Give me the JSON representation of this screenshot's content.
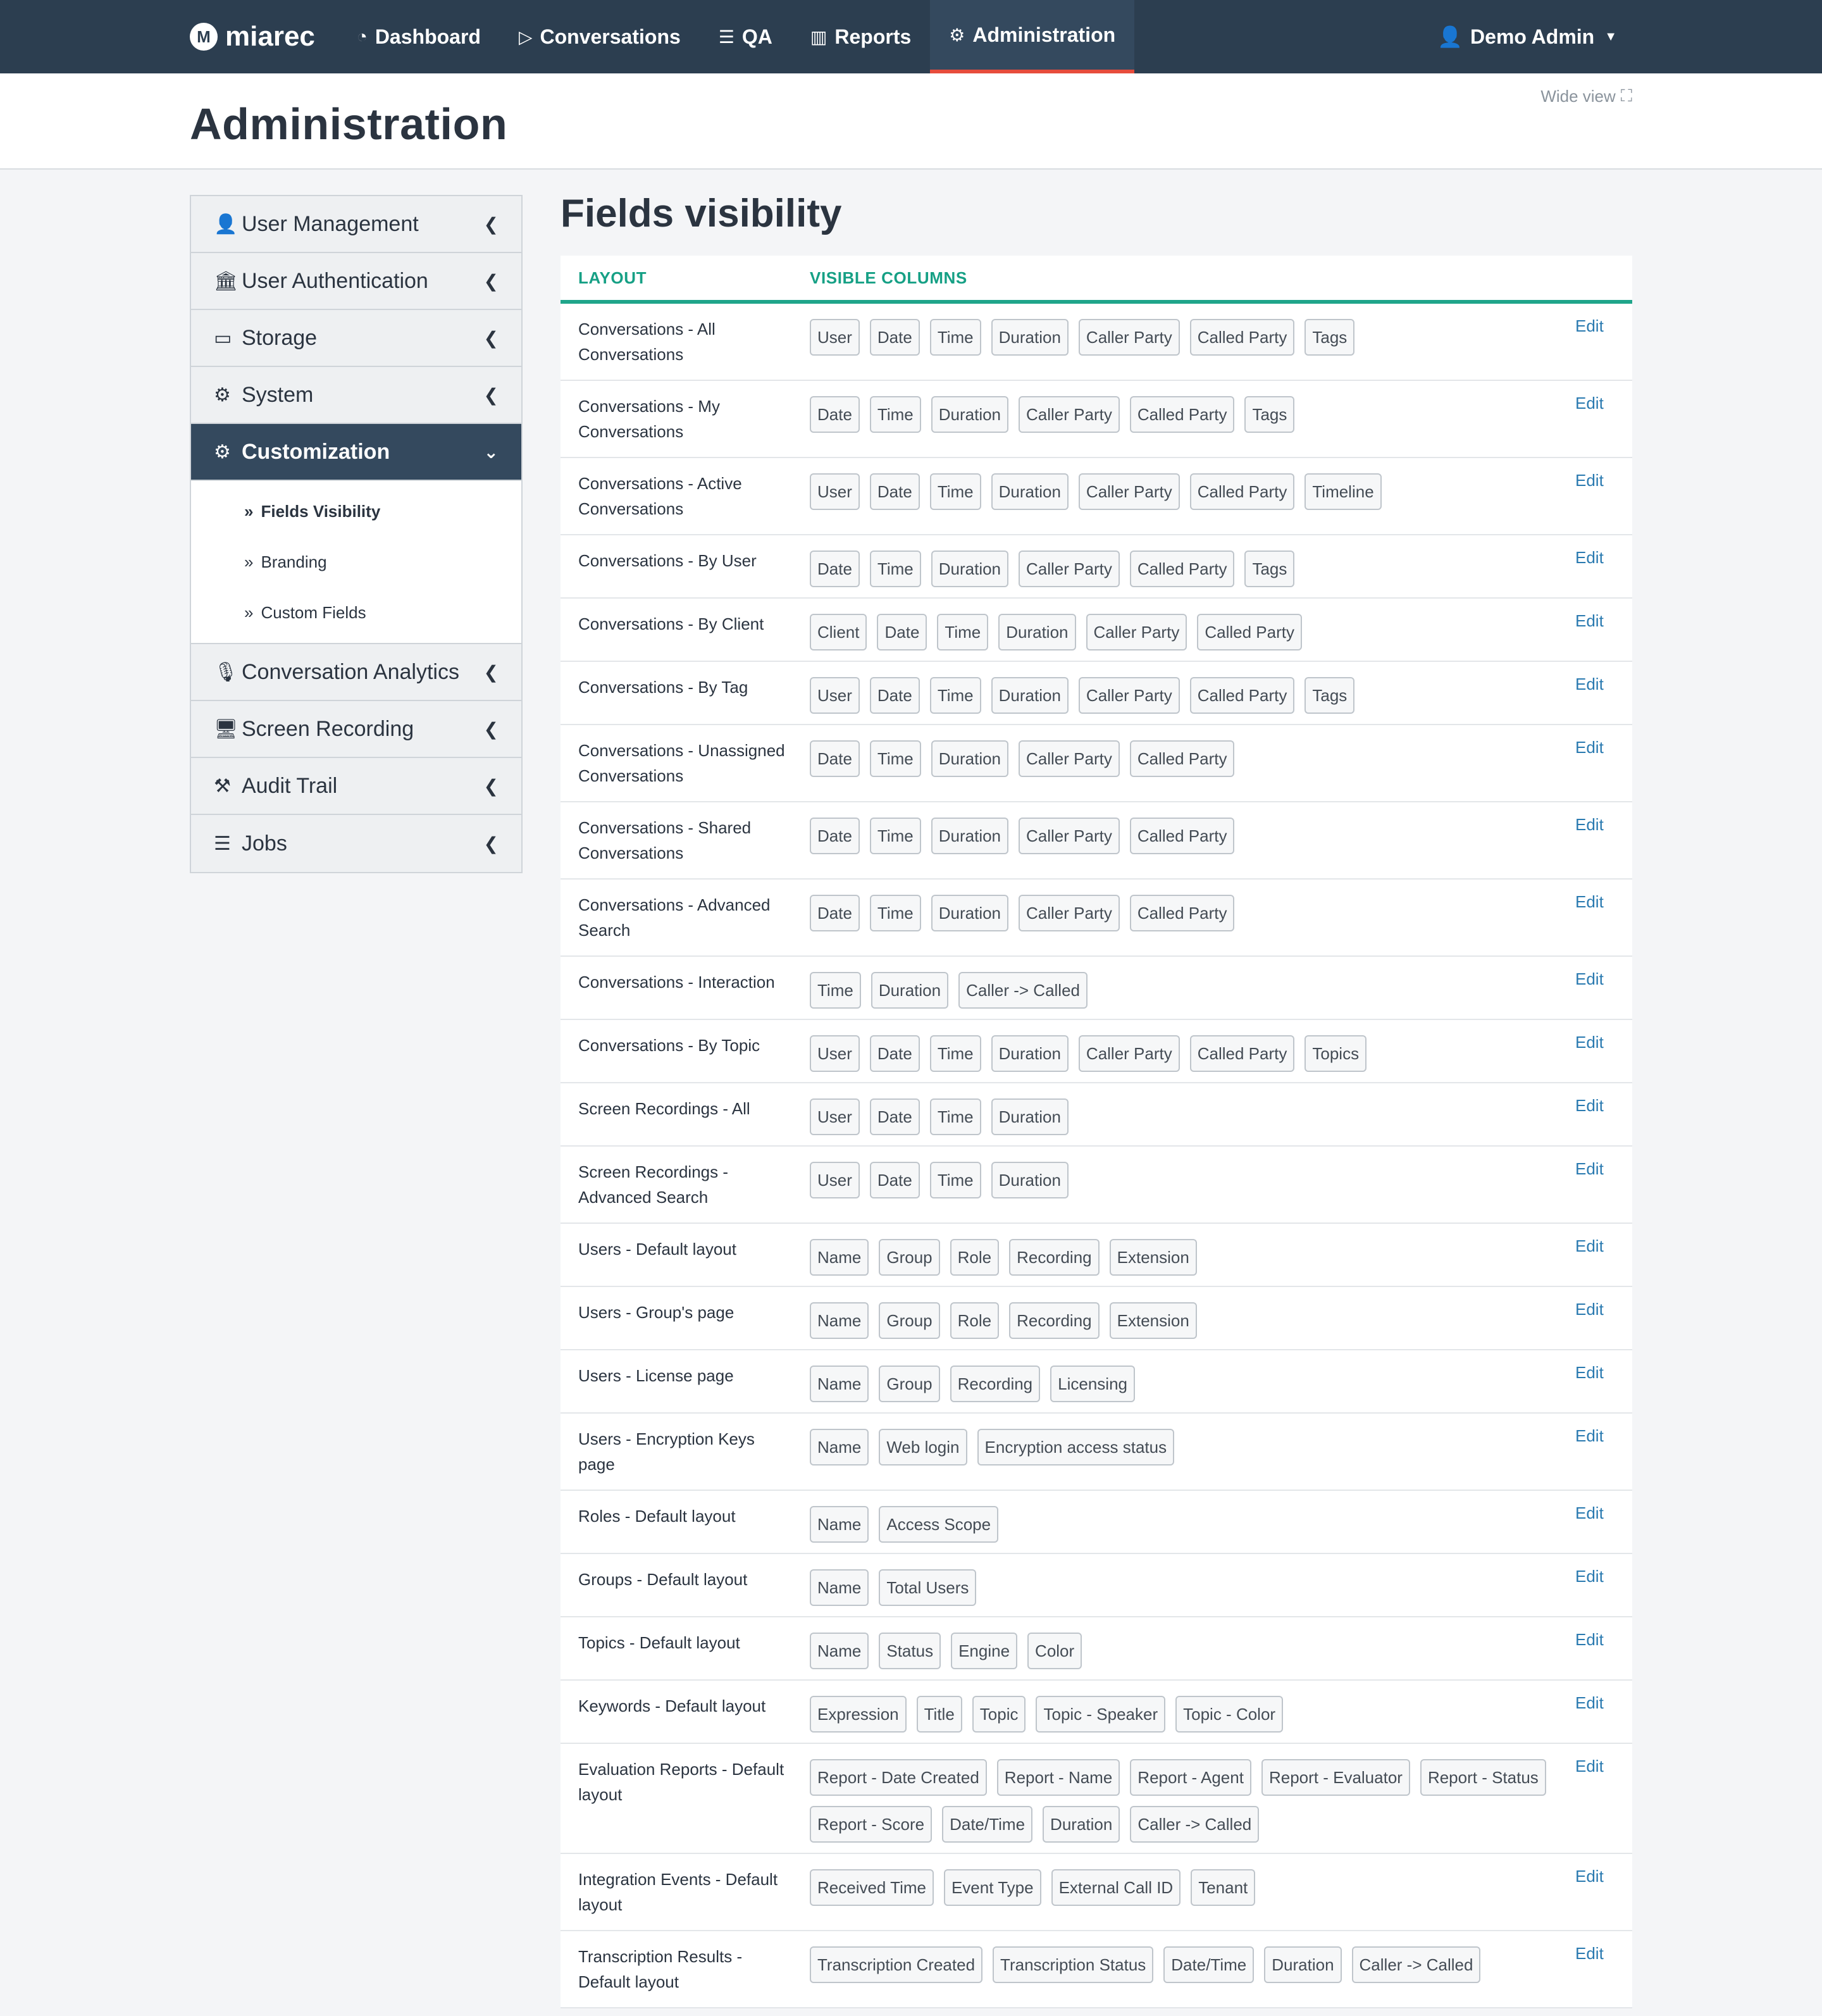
{
  "navbar": {
    "brand": "miarec",
    "items": [
      {
        "label": "Dashboard",
        "icon": "dashboard-icon"
      },
      {
        "label": "Conversations",
        "icon": "play-icon"
      },
      {
        "label": "QA",
        "icon": "list-icon"
      },
      {
        "label": "Reports",
        "icon": "bar-chart-icon"
      },
      {
        "label": "Administration",
        "icon": "gear-icon",
        "active": true
      }
    ],
    "user": "Demo Admin"
  },
  "header": {
    "title": "Administration",
    "wide_view": "Wide view"
  },
  "sidebar": {
    "items": [
      {
        "label": "User Management"
      },
      {
        "label": "User Authentication"
      },
      {
        "label": "Storage"
      },
      {
        "label": "System"
      },
      {
        "label": "Customization",
        "active": true
      },
      {
        "label": "Conversation Analytics"
      },
      {
        "label": "Screen Recording"
      },
      {
        "label": "Audit Trail"
      },
      {
        "label": "Jobs"
      }
    ],
    "submenu": [
      {
        "label": "Fields Visibility",
        "current": true
      },
      {
        "label": "Branding"
      },
      {
        "label": "Custom Fields"
      }
    ]
  },
  "main": {
    "title": "Fields visibility",
    "col_layout": "LAYOUT",
    "col_visible": "VISIBLE COLUMNS",
    "edit_label": "Edit",
    "rows": [
      {
        "layout": "Conversations - All Conversations",
        "cols": [
          "User",
          "Date",
          "Time",
          "Duration",
          "Caller Party",
          "Called Party",
          "Tags"
        ]
      },
      {
        "layout": "Conversations - My Conversations",
        "cols": [
          "Date",
          "Time",
          "Duration",
          "Caller Party",
          "Called Party",
          "Tags"
        ]
      },
      {
        "layout": "Conversations - Active Conversations",
        "cols": [
          "User",
          "Date",
          "Time",
          "Duration",
          "Caller Party",
          "Called Party",
          "Timeline"
        ]
      },
      {
        "layout": "Conversations - By User",
        "cols": [
          "Date",
          "Time",
          "Duration",
          "Caller Party",
          "Called Party",
          "Tags"
        ]
      },
      {
        "layout": "Conversations - By Client",
        "cols": [
          "Client",
          "Date",
          "Time",
          "Duration",
          "Caller Party",
          "Called Party"
        ]
      },
      {
        "layout": "Conversations - By Tag",
        "cols": [
          "User",
          "Date",
          "Time",
          "Duration",
          "Caller Party",
          "Called Party",
          "Tags"
        ]
      },
      {
        "layout": "Conversations - Unassigned Conversations",
        "cols": [
          "Date",
          "Time",
          "Duration",
          "Caller Party",
          "Called Party"
        ]
      },
      {
        "layout": "Conversations - Shared Conversations",
        "cols": [
          "Date",
          "Time",
          "Duration",
          "Caller Party",
          "Called Party"
        ]
      },
      {
        "layout": "Conversations - Advanced Search",
        "cols": [
          "Date",
          "Time",
          "Duration",
          "Caller Party",
          "Called Party"
        ]
      },
      {
        "layout": "Conversations - Interaction",
        "cols": [
          "Time",
          "Duration",
          "Caller -> Called"
        ]
      },
      {
        "layout": "Conversations - By Topic",
        "cols": [
          "User",
          "Date",
          "Time",
          "Duration",
          "Caller Party",
          "Called Party",
          "Topics"
        ]
      },
      {
        "layout": "Screen Recordings - All",
        "cols": [
          "User",
          "Date",
          "Time",
          "Duration"
        ]
      },
      {
        "layout": "Screen Recordings - Advanced Search",
        "cols": [
          "User",
          "Date",
          "Time",
          "Duration"
        ]
      },
      {
        "layout": "Users - Default layout",
        "cols": [
          "Name",
          "Group",
          "Role",
          "Recording",
          "Extension"
        ]
      },
      {
        "layout": "Users - Group's page",
        "cols": [
          "Name",
          "Group",
          "Role",
          "Recording",
          "Extension"
        ]
      },
      {
        "layout": "Users - License page",
        "cols": [
          "Name",
          "Group",
          "Recording",
          "Licensing"
        ]
      },
      {
        "layout": "Users - Encryption Keys page",
        "cols": [
          "Name",
          "Web login",
          "Encryption access status"
        ]
      },
      {
        "layout": "Roles - Default layout",
        "cols": [
          "Name",
          "Access Scope"
        ]
      },
      {
        "layout": "Groups - Default layout",
        "cols": [
          "Name",
          "Total Users"
        ]
      },
      {
        "layout": "Topics - Default layout",
        "cols": [
          "Name",
          "Status",
          "Engine",
          "Color"
        ]
      },
      {
        "layout": "Keywords - Default layout",
        "cols": [
          "Expression",
          "Title",
          "Topic",
          "Topic - Speaker",
          "Topic - Color"
        ]
      },
      {
        "layout": "Evaluation Reports - Default layout",
        "cols": [
          "Report - Date Created",
          "Report - Name",
          "Report - Agent",
          "Report - Evaluator",
          "Report - Status",
          "Report - Score",
          "Date/Time",
          "Duration",
          "Caller -> Called"
        ]
      },
      {
        "layout": "Integration Events - Default layout",
        "cols": [
          "Received Time",
          "Event Type",
          "External Call ID",
          "Tenant"
        ]
      },
      {
        "layout": "Transcription Results - Default layout",
        "cols": [
          "Transcription Created",
          "Transcription Status",
          "Date/Time",
          "Duration",
          "Caller -> Called"
        ]
      }
    ]
  }
}
